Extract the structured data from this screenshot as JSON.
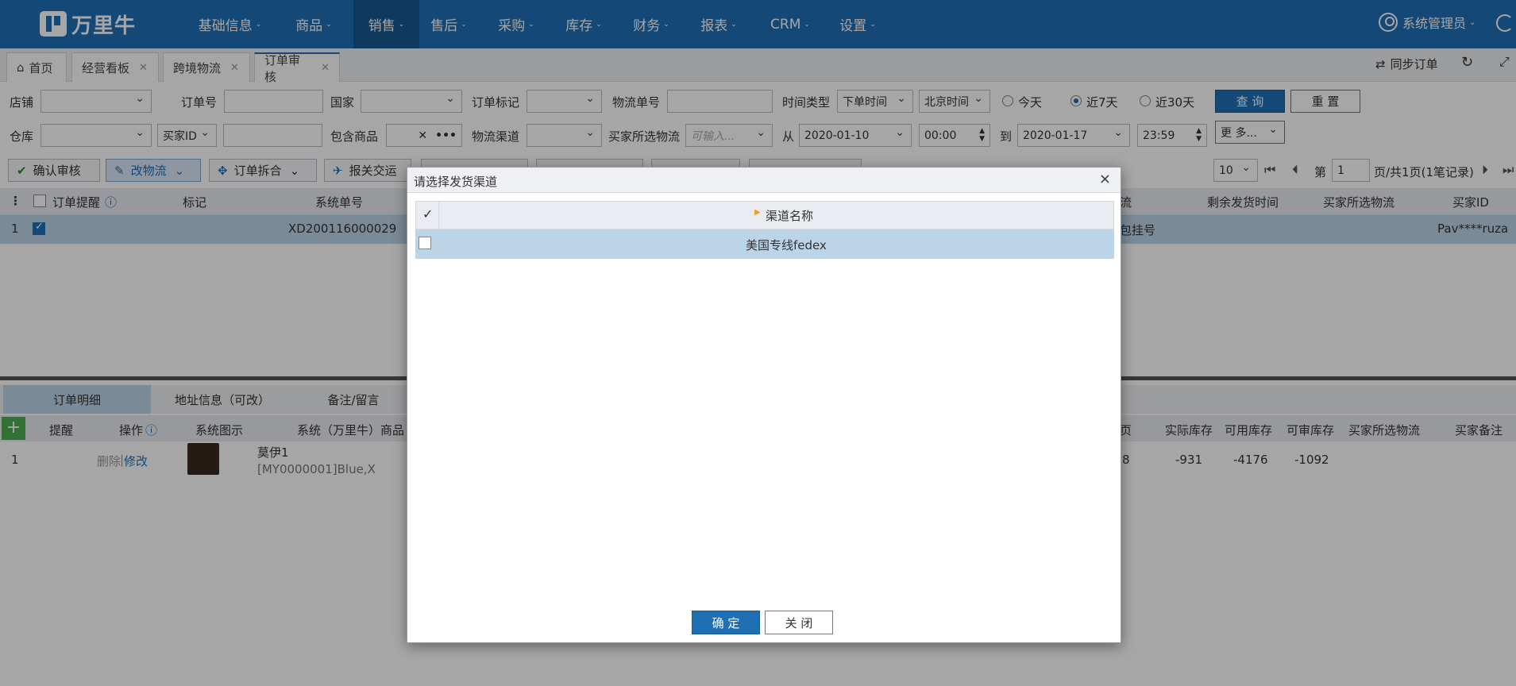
{
  "nav": {
    "logo_text": "万里牛",
    "items": [
      "基础信息",
      "商品",
      "销售",
      "售后",
      "采购",
      "库存",
      "财务",
      "报表",
      "CRM",
      "设置"
    ],
    "user": "系统管理员"
  },
  "tabs": [
    "首页",
    "经营看板",
    "跨境物流",
    "订单审核"
  ],
  "sync_label": "同步订单",
  "filters": {
    "shop": "店铺",
    "order_no": "订单号",
    "country": "国家",
    "order_mark": "订单标记",
    "tracking_no": "物流单号",
    "time_type": "时间类型",
    "time_type_value": "下单时间",
    "timezone_value": "北京时间",
    "today": "今天",
    "last7": "近7天",
    "last30": "近30天",
    "query": "查 询",
    "reset": "重 置",
    "warehouse": "仓库",
    "buyer_id": "买家ID",
    "contains_goods": "包含商品",
    "logistics_channel": "物流渠道",
    "buyer_logistics": "买家所选物流",
    "buyer_logistics_placeholder": "可输入...",
    "from": "从",
    "from_date": "2020-01-10",
    "from_time": "00:00",
    "to": "到",
    "to_date": "2020-01-17",
    "to_time": "23:59",
    "more": "更 多..."
  },
  "toolbar": {
    "confirm": "确认审核",
    "change_logistics": "改物流",
    "split_merge": "订单拆合",
    "customs": "报关交运",
    "page_size": "10",
    "page_prefix": "第",
    "page_no": "1",
    "page_suffix": "页/共1页(1笔记录)"
  },
  "grid": {
    "headers": [
      "订单提醒",
      "标记",
      "系统单号",
      "流",
      "剩余发货时间",
      "买家所选物流",
      "买家ID"
    ],
    "row": {
      "index": "1",
      "order_no": "XD200116000029",
      "logistics": "包挂号",
      "buyer_id": "Pav****ruza"
    }
  },
  "lower": {
    "tabs": [
      "订单明细",
      "地址信息（可改）",
      "备注/留言"
    ],
    "headers": [
      "提醒",
      "操作",
      "系统图示",
      "系统（万里牛）商品",
      "页",
      "实际库存",
      "可用库存",
      "可审库存",
      "买家所选物流",
      "买家备注"
    ],
    "row": {
      "index": "1",
      "delete": "删除",
      "sep": "|",
      "edit": "修改",
      "goods_name": "莫伊1",
      "goods_sku": "[MY0000001]Blue,X",
      "qty_partial": "8",
      "actual_stock": "-931",
      "available_stock": "-4176",
      "auditable_stock": "-1092"
    }
  },
  "dialog": {
    "title": "请选择发货渠道",
    "header_check": "✓",
    "column": "渠道名称",
    "rows": [
      "美国专线fedex"
    ],
    "ok": "确 定",
    "cancel": "关 闭"
  }
}
